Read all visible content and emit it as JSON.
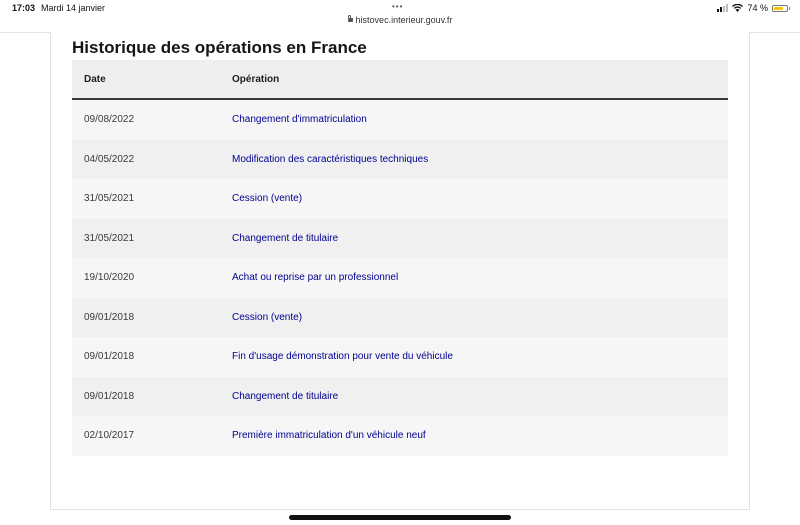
{
  "status_bar": {
    "time": "17:03",
    "date": "Mardi 14 janvier",
    "url": "histovec.interieur.gouv.fr",
    "battery": "74 %",
    "battery_level": 0.74
  },
  "page": {
    "title": "Historique des opérations en France"
  },
  "table": {
    "headers": [
      "Date",
      "Opération"
    ],
    "rows": [
      {
        "date": "09/08/2022",
        "operation": "Changement d'immatriculation"
      },
      {
        "date": "04/05/2022",
        "operation": "Modification des caractéristiques techniques"
      },
      {
        "date": "31/05/2021",
        "operation": "Cession (vente)"
      },
      {
        "date": "31/05/2021",
        "operation": "Changement de titulaire"
      },
      {
        "date": "19/10/2020",
        "operation": "Achat ou reprise par un professionnel"
      },
      {
        "date": "09/01/2018",
        "operation": "Cession (vente)"
      },
      {
        "date": "09/01/2018",
        "operation": "Fin d'usage démonstration pour vente du véhicule"
      },
      {
        "date": "09/01/2018",
        "operation": "Changement de titulaire"
      },
      {
        "date": "02/10/2017",
        "operation": "Première immatriculation d'un véhicule neuf"
      }
    ]
  },
  "colors": {
    "link": "#000091",
    "header_bg": "#eeeeee",
    "battery": "#f5c400"
  }
}
